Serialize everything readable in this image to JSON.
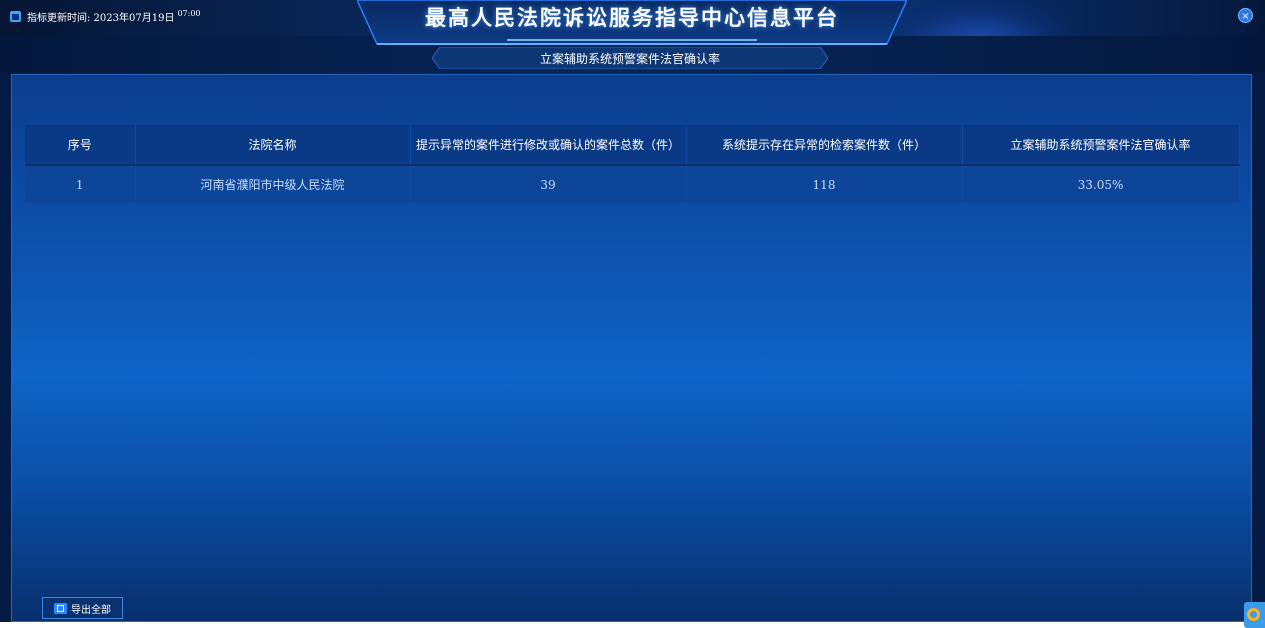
{
  "header": {
    "update_label": "指标更新时间: 2023年07月19日",
    "update_time": "07:00",
    "title": "最高人民法院诉讼服务指导中心信息平台",
    "subtitle": "立案辅助系统预警案件法官确认率"
  },
  "table": {
    "columns": [
      "序号",
      "法院名称",
      "提示异常的案件进行修改或确认的案件总数（件）",
      "系统提示存在异常的检索案件数（件）",
      "立案辅助系统预警案件法官确认率"
    ],
    "rows": [
      {
        "index": "1",
        "court": "河南省濮阳市中级人民法院",
        "confirmed_total": "39",
        "flagged_total": "118",
        "rate": "33.05%"
      }
    ]
  },
  "footer": {
    "export_label": "导出全部"
  },
  "colors": {
    "link_value": "#3fb4ff",
    "panel_bg": "#0e64c8",
    "header_bg": "#0a3a86"
  },
  "icons": [
    "calendar-icon",
    "close-icon",
    "excel-icon",
    "browser-extension-logo-icon"
  ]
}
